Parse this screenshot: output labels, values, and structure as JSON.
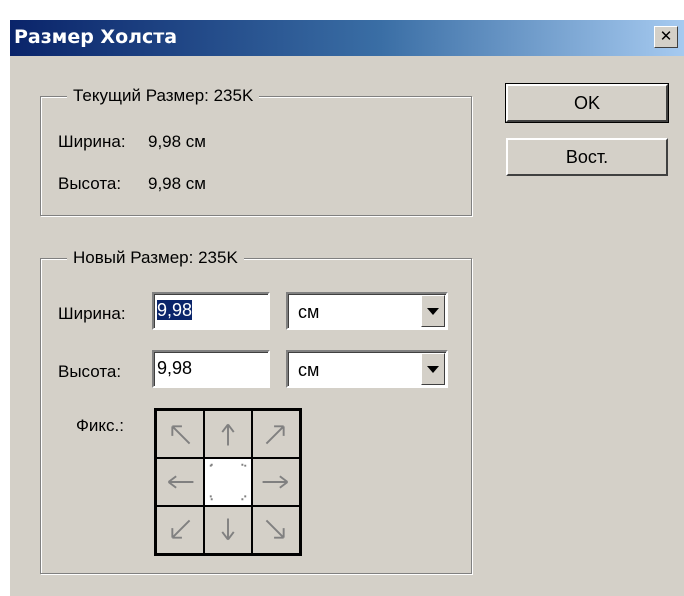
{
  "window": {
    "title": "Размер Холста"
  },
  "current_size": {
    "legend": "Текущий Размер: 235K",
    "width_label": "Ширина:",
    "width_value": "9,98 см",
    "height_label": "Высота:",
    "height_value": "9,98 см"
  },
  "new_size": {
    "legend": "Новый Размер: 235K",
    "width_label": "Ширина:",
    "width_value": "9,98",
    "width_unit": "см",
    "height_label": "Высота:",
    "height_value": "9,98",
    "height_unit": "см",
    "anchor_label": "Фикс.:",
    "anchor_selected": "center"
  },
  "buttons": {
    "ok": "OK",
    "reset": "Вост."
  },
  "colors": {
    "title_gradient_start": "#0a246a",
    "title_gradient_end": "#a6caf0",
    "dialog_bg": "#d4d0c8",
    "selection": "#0a246a"
  }
}
